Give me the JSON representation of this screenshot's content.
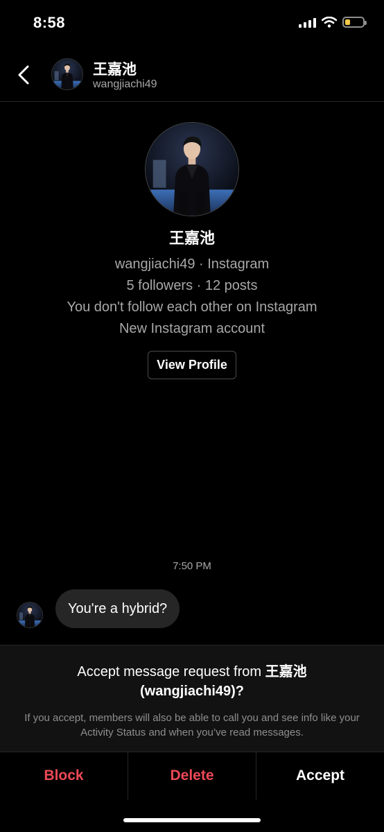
{
  "status": {
    "time": "8:58",
    "battery_color": "#f7c948",
    "battery_level": 0.3
  },
  "header": {
    "name": "王嘉池",
    "handle": "wangjiachi49"
  },
  "profile": {
    "name": "王嘉池",
    "subtitle": "wangjiachi49 · Instagram",
    "stats": "5 followers · 12 posts",
    "relationship": "You don't follow each other on Instagram",
    "account_note": "New Instagram account",
    "view_profile_label": "View Profile"
  },
  "thread": {
    "timestamp": "7:50 PM",
    "message": "You're a hybrid?"
  },
  "request": {
    "title_prefix": "Accept message request from ",
    "title_name": "王嘉池",
    "title_handle": "(wangjiachi49)?",
    "description": "If you accept, members will also be able to call you and see info like your Activity Status and when you’ve read messages."
  },
  "actions": {
    "block": "Block",
    "delete": "Delete",
    "accept": "Accept"
  },
  "colors": {
    "danger": "#ed4956",
    "bubble": "#262626",
    "panel": "#121212"
  }
}
